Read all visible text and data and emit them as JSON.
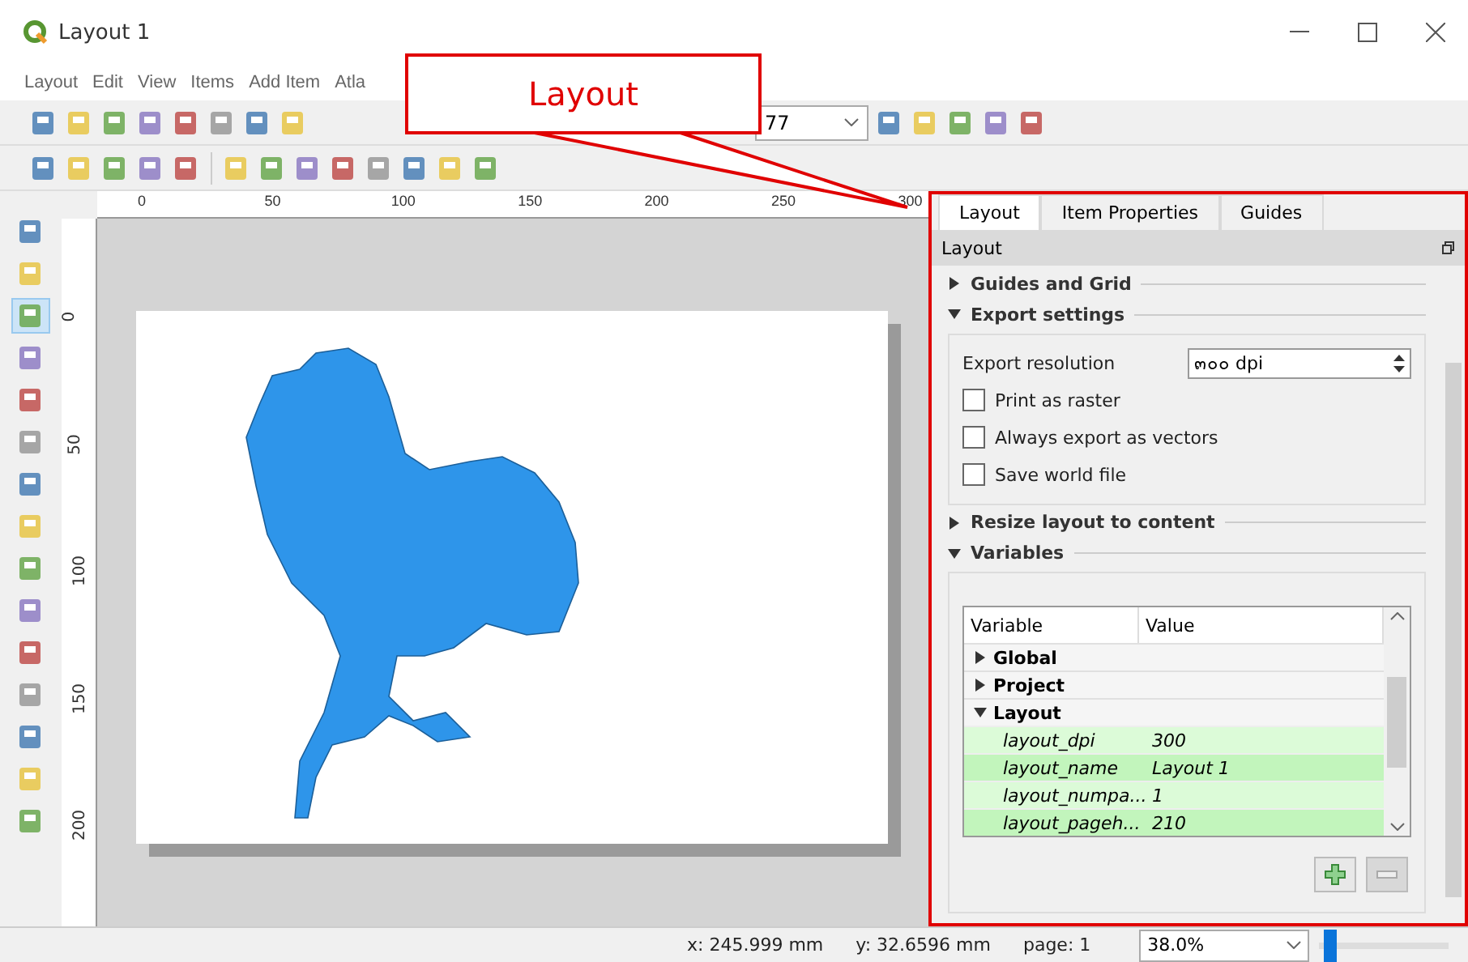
{
  "window": {
    "title": "Layout 1"
  },
  "menu": [
    "Layout",
    "Edit",
    "View",
    "Items",
    "Add Item",
    "Atla"
  ],
  "atlas_field": {
    "value": "77"
  },
  "callout": {
    "text": "Layout"
  },
  "ruler": {
    "horizontal": [
      "0",
      "50",
      "100",
      "150",
      "200",
      "250",
      "300"
    ],
    "vertical": [
      "0",
      "50",
      "100",
      "150",
      "200"
    ]
  },
  "dock": {
    "tabs": [
      {
        "label": "Layout",
        "selected": true
      },
      {
        "label": "Item Properties",
        "selected": false
      },
      {
        "label": "Guides",
        "selected": false
      }
    ],
    "title": "Layout",
    "sections": [
      {
        "title": "Guides and Grid",
        "expanded": false
      },
      {
        "title": "Export settings",
        "expanded": true,
        "kind": "export"
      },
      {
        "title": "Resize layout to content",
        "expanded": false
      },
      {
        "title": "Variables",
        "expanded": true,
        "kind": "variables"
      }
    ],
    "export": {
      "resolution_label": "Export resolution",
      "resolution_value": "๓๐๐ dpi",
      "options": [
        {
          "label": "Print as raster",
          "checked": false
        },
        {
          "label": "Always export as vectors",
          "checked": false
        },
        {
          "label": "Save world file",
          "checked": false
        }
      ]
    },
    "variables": {
      "columns": [
        "Variable",
        "Value"
      ],
      "groups": [
        {
          "name": "Global",
          "expanded": false
        },
        {
          "name": "Project",
          "expanded": false
        },
        {
          "name": "Layout",
          "expanded": true,
          "rows": [
            {
              "name": "layout_dpi",
              "value": "300"
            },
            {
              "name": "layout_name",
              "value": "Layout 1"
            },
            {
              "name": "layout_numpa...",
              "value": "1"
            },
            {
              "name": "layout_pageh...",
              "value": "210"
            }
          ]
        }
      ]
    }
  },
  "status_bar": {
    "x": "x: 245.999 mm",
    "y": "y: 32.6596 mm",
    "page": "page: 1",
    "zoom": "38.0%",
    "zoom_slider": {
      "level": 0.03
    }
  }
}
